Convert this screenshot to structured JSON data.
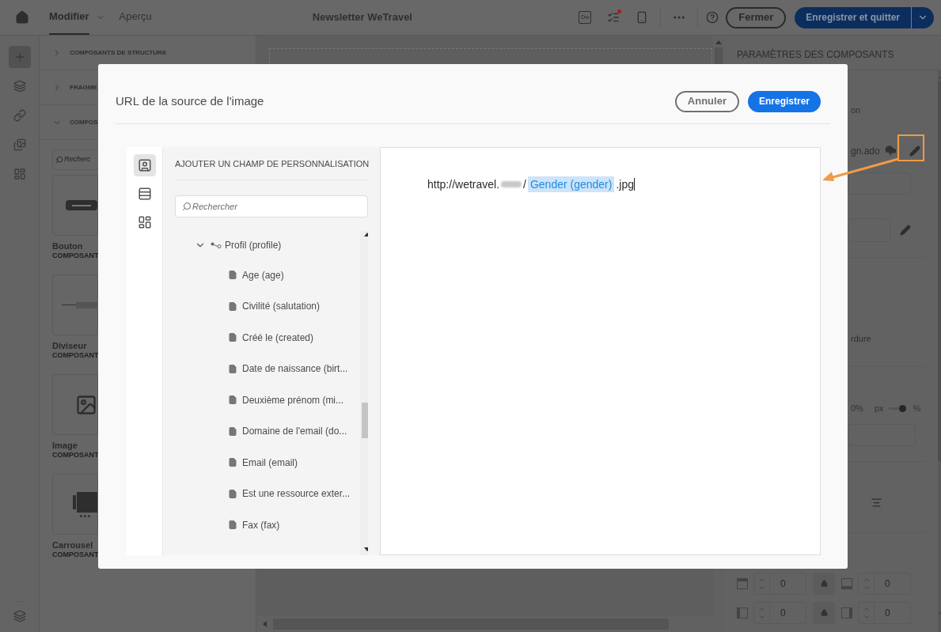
{
  "top_bar": {
    "tabs": [
      {
        "label": "Modifier",
        "selected": true
      },
      {
        "label": "Aperçu",
        "selected": false
      }
    ],
    "title": "Newsletter WeTravel",
    "tool_badge": "Dw",
    "close_button": "Fermer",
    "save_button": "Enregistrer et quitter"
  },
  "rail": [
    {
      "kind": "add",
      "selected": true
    },
    {
      "kind": "layers",
      "selected": false
    },
    {
      "kind": "link",
      "selected": false
    },
    {
      "kind": "media",
      "selected": false
    },
    {
      "kind": "grid",
      "selected": false
    }
  ],
  "components_panel": {
    "sections": [
      {
        "label": "COMPOSANTS DE STRUCTURE",
        "expanded": false
      },
      {
        "label": "FRAGME",
        "expanded": false
      },
      {
        "label": "COMPOS",
        "expanded": true
      }
    ],
    "search": {
      "placeholder": "Recherc"
    },
    "items": [
      {
        "kind": "button",
        "name": "Bouton",
        "type": "COMPOSANT"
      },
      {
        "kind": "divider",
        "name": "Diviseur",
        "type": "COMPOSANT"
      },
      {
        "kind": "image",
        "name": "Image",
        "type": "COMPOSANT"
      },
      {
        "kind": "carousel",
        "name": "Carrousel",
        "type": "COMPOSANT"
      }
    ]
  },
  "settings_panel": {
    "title": "PARAMÈTRES DES COMPOSANTS",
    "option_text": "on",
    "file_name": "gn.ado",
    "border_label": "rdure",
    "width_value": "0%",
    "unit_left": "px",
    "unit_switch": {
      "on": true
    },
    "unit_right": "%",
    "spacing": [
      {
        "value": "0"
      },
      {
        "value": "0"
      },
      {
        "value": "0"
      },
      {
        "value": "0"
      }
    ]
  },
  "dialog": {
    "title": "URL de la source de l'image",
    "cancel_button": "Annuler",
    "save_button": "Enregistrer",
    "tabs": [
      {
        "kind": "profile",
        "selected": true
      },
      {
        "kind": "table",
        "selected": false
      },
      {
        "kind": "blocks",
        "selected": false
      }
    ],
    "panel_title": "AJOUTER UN CHAMP DE PERSONNALISATION",
    "search": {
      "placeholder": "Rechercher"
    },
    "tree": [
      {
        "label": "Profil (profile)",
        "expanded": true,
        "children": [
          {
            "label": "Age (age)"
          },
          {
            "label": "Civilité (salutation)"
          },
          {
            "label": "Créé le (created)"
          },
          {
            "label": "Date de naissance (birt..."
          },
          {
            "label": "Deuxième prénom (mi..."
          },
          {
            "label": "Domaine de l'email (do..."
          },
          {
            "label": "Email (email)"
          },
          {
            "label": "Est une ressource exter..."
          },
          {
            "label": "Fax (fax)"
          }
        ]
      }
    ],
    "editor": {
      "segments": [
        {
          "kind": "text",
          "text": "http://wetravel."
        },
        {
          "kind": "redacted"
        },
        {
          "kind": "text",
          "text": "/"
        },
        {
          "kind": "field",
          "text": "Gender (gender)"
        },
        {
          "kind": "text",
          "text": ".jpg"
        }
      ]
    }
  }
}
